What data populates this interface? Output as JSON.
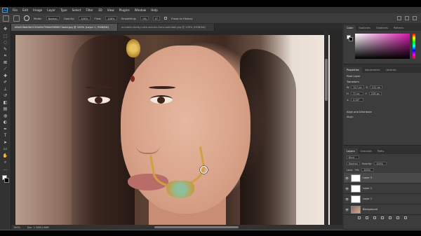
{
  "menu": [
    "File",
    "Edit",
    "Image",
    "Layer",
    "Type",
    "Select",
    "Filter",
    "3D",
    "View",
    "Plugins",
    "Window",
    "Help"
  ],
  "options": {
    "mode_label": "Mode:",
    "mode_value": "Normal",
    "opacity_label": "Opacity:",
    "opacity_value": "100%",
    "flow_label": "Flow:",
    "flow_value": "100%",
    "smoothing_label": "Smoothing:",
    "smoothing_value": "0%",
    "angle_value": "0°",
    "erase_history_label": "Erase to History"
  },
  "doc_tabs": [
    {
      "label": "e6a028eb0b21f54e9e796d40566074add.jpg @ 100% (Layer 1, RGB/8#)",
      "active": true
    },
    {
      "label": "onceblo-shetty-cute-scenes-from-bahubali.jpg @ 100% (RGB/8#)",
      "active": false
    }
  ],
  "status": {
    "zoom": "100%",
    "doc": "Doc: 1.35M/1.68M"
  },
  "color_panel": {
    "tabs": [
      "Color",
      "Swatches",
      "Gradients",
      "Patterns"
    ]
  },
  "properties_panel": {
    "tabs": [
      "Properties",
      "Adjustments",
      "Libraries"
    ],
    "type_label": "Pixel Layer",
    "transform_label": "Transform",
    "w_label": "W",
    "w_value": "517 px",
    "h_label": "H",
    "h_value": "72 px",
    "x_label": "X",
    "x_value": "212 px",
    "y_label": "Y",
    "y_value": "228 px",
    "angle_value": "0.00°",
    "align_label": "Align and Distribute",
    "align_sub": "Align:"
  },
  "layers_panel": {
    "tabs": [
      "Layers",
      "Channels",
      "Paths"
    ],
    "kind_label": "Kind",
    "blend_value": "Normal",
    "opacity_label": "Opacity:",
    "opacity_value": "100%",
    "lock_label": "Lock:",
    "fill_label": "Fill:",
    "fill_value": "100%",
    "layers": [
      {
        "name": "Layer 3",
        "selected": true
      },
      {
        "name": "Layer 2",
        "selected": false
      },
      {
        "name": "Layer 1",
        "selected": false
      },
      {
        "name": "Background",
        "selected": false
      }
    ]
  },
  "colors": {
    "accent": "#31a8ff",
    "picker_hue": "#d31aa8"
  }
}
